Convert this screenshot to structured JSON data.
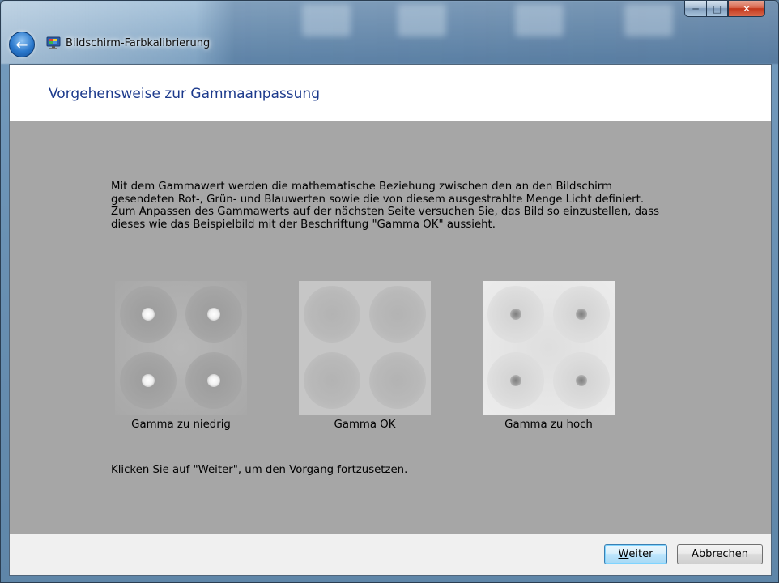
{
  "window": {
    "title": "Bildschirm-Farbkalibrierung",
    "caption_buttons": {
      "minimize_icon": "minimize-icon",
      "maximize_icon": "maximize-icon",
      "close_icon": "close-icon"
    }
  },
  "page": {
    "title": "Vorgehensweise zur Gammaanpassung",
    "intro_paragraph_1": "Mit dem Gammawert werden die mathematische Beziehung zwischen den an den Bildschirm gesendeten Rot-, Grün- und Blauwerten sowie die von diesem ausgestrahlte Menge Licht definiert.",
    "intro_paragraph_2": "Zum Anpassen des Gammawerts auf der nächsten Seite versuchen Sie, das Bild so einzustellen, dass dieses wie das Beispielbild mit der Beschriftung \"Gamma OK\" aussieht.",
    "samples": [
      {
        "label": "Gamma zu niedrig"
      },
      {
        "label": "Gamma OK"
      },
      {
        "label": "Gamma zu hoch"
      }
    ],
    "footer_text": "Klicken Sie auf \"Weiter\", um den Vorgang fortzusetzen."
  },
  "buttons": {
    "next_label_accel": "W",
    "next_label_rest": "eiter",
    "cancel_label": "Abbrechen"
  },
  "colors": {
    "client_background": "#a6a6a6",
    "title_color": "#1c3a8c"
  }
}
